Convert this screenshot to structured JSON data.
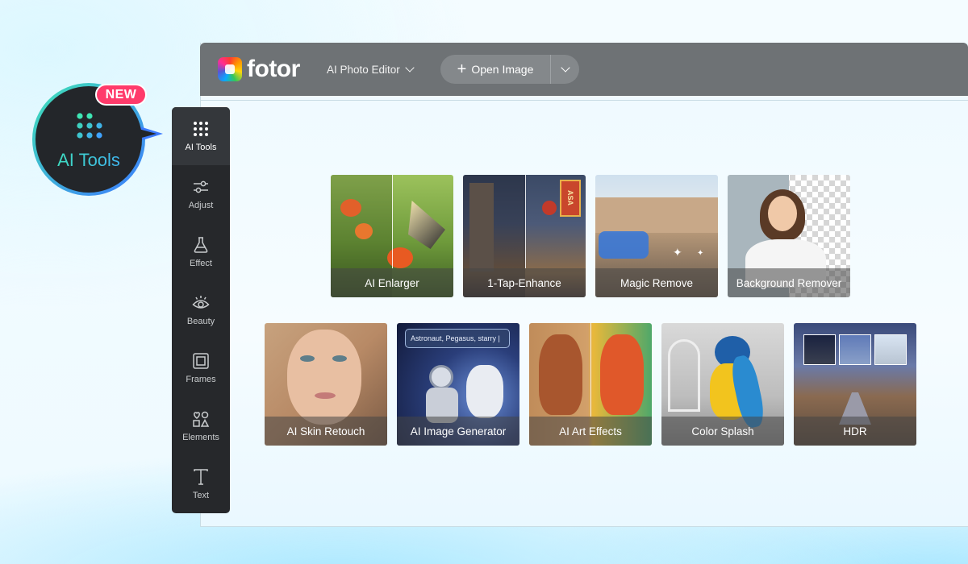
{
  "callout": {
    "badge": "NEW",
    "label": "AI Tools"
  },
  "header": {
    "logo_text": "fotor",
    "editor_menu": "AI Photo Editor",
    "open_image_label": "Open Image"
  },
  "sidebar": {
    "items": [
      {
        "label": "AI Tools",
        "icon": "grid-dots-icon",
        "active": true
      },
      {
        "label": "Adjust",
        "icon": "sliders-icon"
      },
      {
        "label": "Effect",
        "icon": "flask-icon"
      },
      {
        "label": "Beauty",
        "icon": "eye-icon"
      },
      {
        "label": "Frames",
        "icon": "frame-icon"
      },
      {
        "label": "Elements",
        "icon": "shapes-icon"
      },
      {
        "label": "Text",
        "icon": "text-icon"
      }
    ]
  },
  "tools": {
    "row1": [
      "AI Enlarger",
      "1-Tap-Enhance",
      "Magic Remove",
      "Background Remover"
    ],
    "row2": [
      "AI Skin Retouch",
      "AI Image Generator",
      "AI Art Effects",
      "Color Splash",
      "HDR"
    ],
    "prompt_text": "Astronaut, Pegasus, starry |",
    "sign_text": "ASA"
  },
  "colors": {
    "sidebar_bg": "#26282b",
    "topbar_bg": "#6e7275",
    "badge": "#ff3b6b",
    "accent_gradient_start": "#3ee8b0",
    "accent_gradient_end": "#3fa9ff"
  }
}
